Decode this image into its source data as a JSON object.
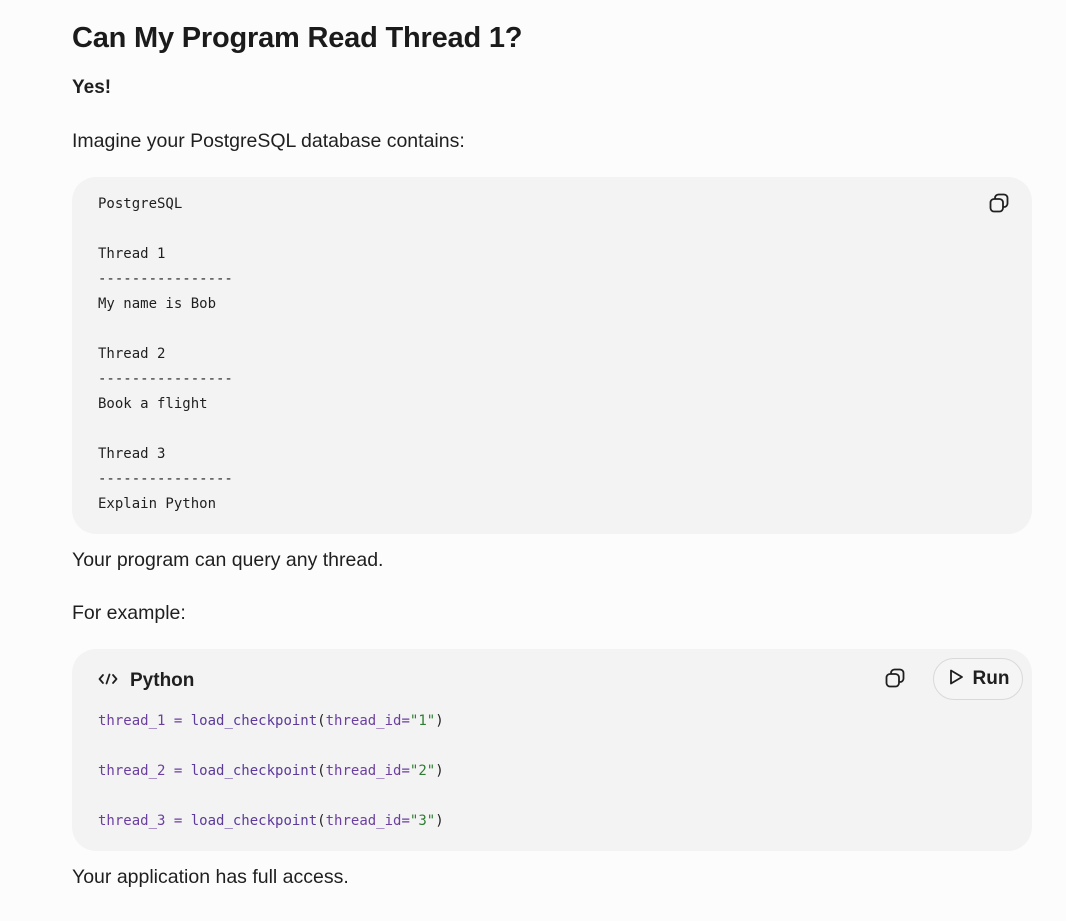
{
  "heading": "Can My Program Read Thread 1?",
  "answer": "Yes!",
  "intro": "Imagine your PostgreSQL database contains:",
  "code_block_1": {
    "lines": [
      "PostgreSQL",
      "",
      "Thread 1",
      "----------------",
      "My name is Bob",
      "",
      "Thread 2",
      "----------------",
      "Book a flight",
      "",
      "Thread 3",
      "----------------",
      "Explain Python"
    ],
    "copy_icon": "copy-icon"
  },
  "query_text": "Your program can query any thread.",
  "example_text": "For example:",
  "code_block_2": {
    "language": "Python",
    "language_icon": "code-icon",
    "copy_icon": "copy-icon",
    "run_label": "Run",
    "run_icon": "play-icon",
    "lines": [
      {
        "var": "thread_1",
        "op": " = ",
        "fn": "load_checkpoint",
        "open": "(",
        "kw": "thread_id",
        "eq": "=",
        "str": "\"1\"",
        "close": ")"
      },
      {
        "var": "thread_2",
        "op": " = ",
        "fn": "load_checkpoint",
        "open": "(",
        "kw": "thread_id",
        "eq": "=",
        "str": "\"2\"",
        "close": ")"
      },
      {
        "var": "thread_3",
        "op": " = ",
        "fn": "load_checkpoint",
        "open": "(",
        "kw": "thread_id",
        "eq": "=",
        "str": "\"3\"",
        "close": ")"
      }
    ]
  },
  "closing_text": "Your application has full access.",
  "colors": {
    "background": "#fcfcfc",
    "code_background": "#f3f3f3",
    "identifier": "#6b3fa0",
    "string": "#2e7d32"
  }
}
